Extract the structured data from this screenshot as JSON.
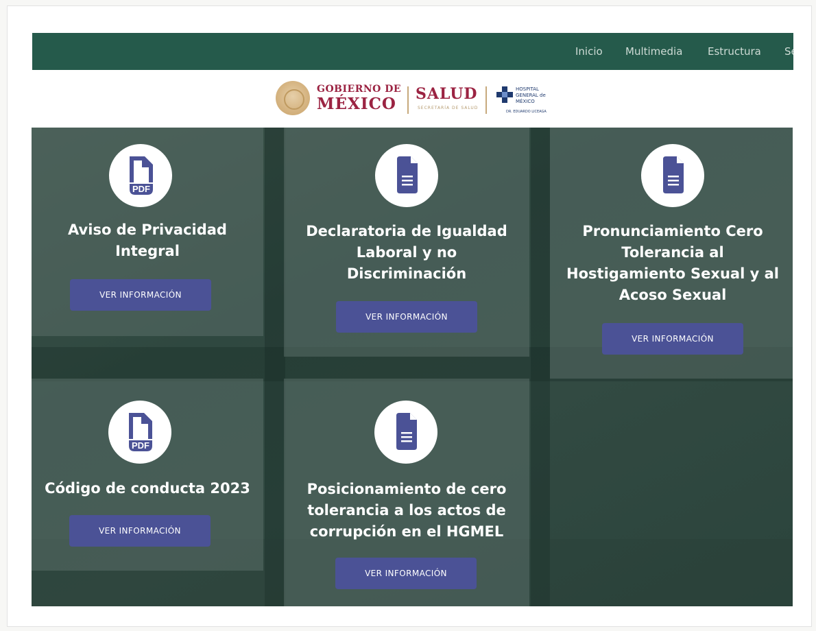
{
  "nav": {
    "items": [
      "Inicio",
      "Multimedia",
      "Estructura",
      "Se"
    ]
  },
  "logos": {
    "gobierno_top": "GOBIERNO DE",
    "gobierno_bottom": "MÉXICO",
    "salud_title": "SALUD",
    "salud_sub": "SECRETARÍA DE SALUD",
    "hospital_lines": "HOSPITAL GENERAL de MÉXICO",
    "hospital_small": "DR. EDUARDO LICEAGA"
  },
  "cards": [
    {
      "icon": "pdf-icon",
      "title": "Aviso de Privacidad Integral",
      "button": "VER INFORMACIÓN"
    },
    {
      "icon": "document-icon",
      "title": "Declaratoria de Igualdad Laboral y no Discriminación",
      "button": "VER INFORMACIÓN"
    },
    {
      "icon": "document-icon",
      "title": "Pronunciamiento Cero Tolerancia al Hostigamiento Sexual y al Acoso Sexual",
      "button": "VER INFORMACIÓN"
    },
    {
      "icon": "pdf-icon",
      "title": "Código de conducta 2023",
      "button": "VER INFORMACIÓN"
    },
    {
      "icon": "document-icon",
      "title": "Posicionamiento de cero tolerancia a los actos de corrupción en el HGMEL",
      "button": "VER INFORMACIÓN"
    }
  ],
  "colors": {
    "nav_bg": "#255a4b",
    "button_bg": "#4b5296",
    "icon_color": "#4b5296",
    "brand_maroon": "#9b2342"
  }
}
